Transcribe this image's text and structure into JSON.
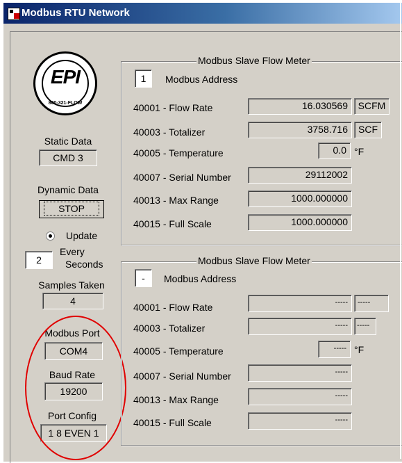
{
  "window": {
    "title": "Modbus RTU Network"
  },
  "logo": {
    "brand": "EPI",
    "phone": "800-321-FLOW"
  },
  "left": {
    "static_data_label": "Static Data",
    "cmd_button": "CMD 3",
    "dynamic_data_label": "Dynamic Data",
    "stop_button": "STOP",
    "update_label": "Update",
    "every_interval": "2",
    "every_label": "Every",
    "seconds_label": "Seconds",
    "samples_label": "Samples Taken",
    "samples_value": "4",
    "port_label": "Modbus Port",
    "port_value": "COM4",
    "baud_label": "Baud Rate",
    "baud_value": "19200",
    "config_label": "Port Config",
    "config_value": "1 8 EVEN 1"
  },
  "meter1": {
    "title": "Modbus Slave Flow Meter",
    "address": "1",
    "address_label": "Modbus Address",
    "rows": [
      {
        "label": "40001 - Flow Rate",
        "value": "16.030569",
        "unit": "SCFM"
      },
      {
        "label": "40003 - Totalizer",
        "value": "3758.716",
        "unit": "SCF"
      },
      {
        "label": "40005 - Temperature",
        "value": "0.0",
        "unit": "°F"
      },
      {
        "label": "40007 - Serial Number",
        "value": "29112002"
      },
      {
        "label": "40013 - Max Range",
        "value": "1000.000000"
      },
      {
        "label": "40015 - Full Scale",
        "value": "1000.000000"
      }
    ]
  },
  "meter2": {
    "title": "Modbus Slave Flow Meter",
    "address": "-",
    "address_label": "Modbus Address",
    "rows": [
      {
        "label": "40001 - Flow Rate",
        "value": "-----",
        "unit": "-----"
      },
      {
        "label": "40003 - Totalizer",
        "value": "-----",
        "unit": "-----"
      },
      {
        "label": "40005 - Temperature",
        "value": "-----",
        "unit": "°F"
      },
      {
        "label": "40007 - Serial Number",
        "value": "-----"
      },
      {
        "label": "40013 - Max Range",
        "value": "-----"
      },
      {
        "label": "40015 - Full Scale",
        "value": "-----"
      }
    ]
  },
  "annotation": {
    "color": "#e00000"
  }
}
